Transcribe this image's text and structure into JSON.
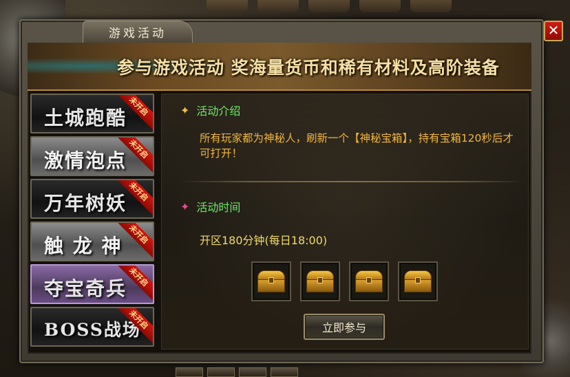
{
  "window": {
    "title": "游戏活动",
    "close_label": "✕"
  },
  "banner": {
    "text": "参与游戏活动 奖海量货币和稀有材料及高阶装备"
  },
  "activity_list": {
    "items": [
      {
        "label": "土城跑酷",
        "badge": "未开启"
      },
      {
        "label": "激情泡点",
        "badge": "未开启"
      },
      {
        "label": "万年树妖",
        "badge": "未开启"
      },
      {
        "label": "触 龙 神",
        "badge": "未开启"
      },
      {
        "label": "夺宝奇兵",
        "badge": "未开启"
      },
      {
        "label": "BOSS战场",
        "badge": "未开启"
      }
    ],
    "selected": "夺宝奇兵"
  },
  "details": {
    "intro_title": "活动介绍",
    "intro_text": "所有玩家都为神秘人，刷新一个【神秘宝箱】，持有宝箱120秒后才可打开！",
    "time_title": "活动时间",
    "time_text": "开区180分钟(每日18:00)",
    "rewards": [
      "treasure-chest-icon",
      "treasure-chest-icon",
      "treasure-chest-icon",
      "treasure-chest-icon"
    ],
    "join_label": "立即参与"
  },
  "colors": {
    "section_title": "#6fe86a",
    "description": "#f2b640",
    "time_text": "#f2dc6a",
    "close_button": "#d11c10",
    "badge": "#d3160c"
  }
}
